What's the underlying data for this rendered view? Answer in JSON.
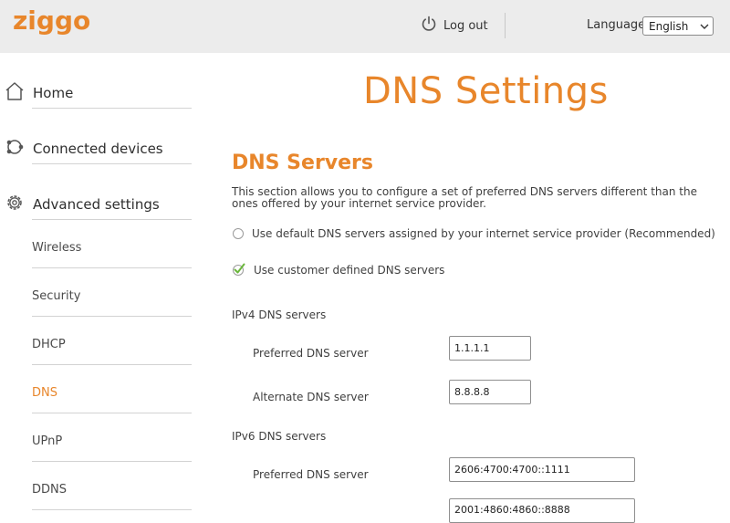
{
  "header": {
    "brand": "ziggo",
    "logout_label": "Log out",
    "language_label": "Language",
    "language_value": "English"
  },
  "sidebar": {
    "main_items": [
      {
        "label": "Home",
        "icon": "home-icon"
      },
      {
        "label": "Connected devices",
        "icon": "devices-icon"
      },
      {
        "label": "Advanced settings",
        "icon": "gear-icon"
      }
    ],
    "sub_items": [
      {
        "label": "Wireless"
      },
      {
        "label": "Security"
      },
      {
        "label": "DHCP"
      },
      {
        "label": "DNS",
        "active": true
      },
      {
        "label": "UPnP"
      },
      {
        "label": "DDNS"
      }
    ]
  },
  "main": {
    "title": "DNS Settings",
    "section_title": "DNS Servers",
    "section_description": "This section allows you to configure a set of preferred DNS servers different than the ones offered by your internet service provider.",
    "options": [
      {
        "label": "Use default DNS servers assigned by your internet service provider (Recommended)",
        "selected": false
      },
      {
        "label": "Use customer defined DNS servers",
        "selected": true
      }
    ],
    "ipv4": {
      "label": "IPv4 DNS servers",
      "preferred_label": "Preferred DNS server",
      "preferred_value": "1.1.1.1",
      "alternate_label": "Alternate DNS server",
      "alternate_value": "8.8.8.8"
    },
    "ipv6": {
      "label": "IPv6 DNS servers",
      "preferred_label": "Preferred DNS server",
      "preferred_value": "2606:4700:4700::1111",
      "alternate_value": "2001:4860:4860::8888"
    }
  },
  "colors": {
    "accent": "#e8862b",
    "header_bg": "#ececec",
    "check": "#6bb63c"
  }
}
